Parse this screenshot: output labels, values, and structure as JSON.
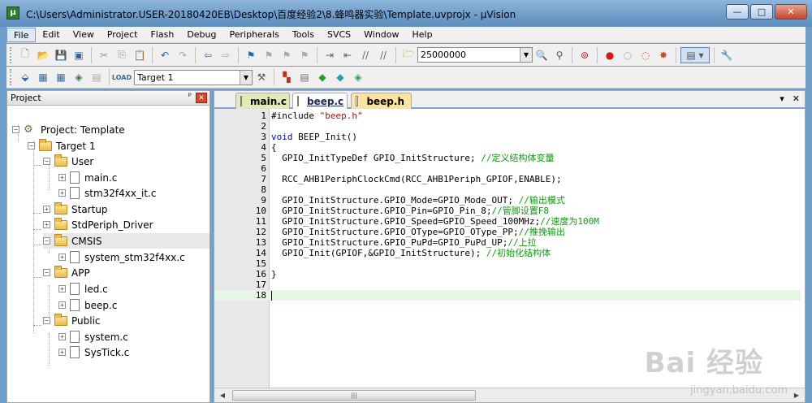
{
  "window": {
    "title": "C:\\Users\\Administrator.USER-20180420EB\\Desktop\\百度经验2\\8.蜂鸣器实验\\Template.uvprojx - µVision",
    "app_icon": "uvision-icon",
    "buttons": {
      "minimize": "—",
      "maximize": "□",
      "close": "✕"
    }
  },
  "menu": [
    "File",
    "Edit",
    "View",
    "Project",
    "Flash",
    "Debug",
    "Peripherals",
    "Tools",
    "SVCS",
    "Window",
    "Help"
  ],
  "toolbar": {
    "find_value": "25000000",
    "target_value": "Target 1"
  },
  "project_panel": {
    "title": "Project",
    "pin": "ᵖ",
    "close": "✕",
    "tree": [
      {
        "label": "Project: Template",
        "type": "project"
      },
      {
        "label": "Target 1",
        "type": "target"
      },
      {
        "label": "User",
        "type": "folder"
      },
      {
        "label": "main.c",
        "type": "file"
      },
      {
        "label": "stm32f4xx_it.c",
        "type": "file"
      },
      {
        "label": "Startup",
        "type": "folder"
      },
      {
        "label": "StdPeriph_Driver",
        "type": "folder"
      },
      {
        "label": "CMSIS",
        "type": "folder"
      },
      {
        "label": "system_stm32f4xx.c",
        "type": "file"
      },
      {
        "label": "APP",
        "type": "folder"
      },
      {
        "label": "led.c",
        "type": "file"
      },
      {
        "label": "beep.c",
        "type": "file"
      },
      {
        "label": "Public",
        "type": "folder"
      },
      {
        "label": "system.c",
        "type": "file"
      },
      {
        "label": "SysTick.c",
        "type": "file"
      }
    ]
  },
  "tabs": [
    {
      "label": "main.c"
    },
    {
      "label": "beep.c",
      "active": true
    },
    {
      "label": "beep.h"
    }
  ],
  "tab_actions": {
    "menu": "▾",
    "close": "✕"
  },
  "code": [
    {
      "n": "1",
      "parts": [
        {
          "t": "#include ",
          "c": ""
        },
        {
          "t": "\"beep.h\"",
          "c": "str"
        }
      ]
    },
    {
      "n": "2",
      "parts": []
    },
    {
      "n": "3",
      "parts": [
        {
          "t": "void",
          "c": "kw"
        },
        {
          "t": " BEEP_Init()",
          "c": ""
        }
      ]
    },
    {
      "n": "4",
      "parts": [
        {
          "t": "{",
          "c": ""
        }
      ]
    },
    {
      "n": "5",
      "parts": [
        {
          "t": "  GPIO_InitTypeDef GPIO_InitStructure; ",
          "c": ""
        },
        {
          "t": "//定义结构体变量",
          "c": "cmt"
        }
      ]
    },
    {
      "n": "6",
      "parts": []
    },
    {
      "n": "7",
      "parts": [
        {
          "t": "  RCC_AHB1PeriphClockCmd(RCC_AHB1Periph_GPIOF,ENABLE);",
          "c": ""
        }
      ]
    },
    {
      "n": "8",
      "parts": []
    },
    {
      "n": "9",
      "parts": [
        {
          "t": "  GPIO_InitStructure.GPIO_Mode=GPIO_Mode_OUT; ",
          "c": ""
        },
        {
          "t": "//输出模式",
          "c": "cmt"
        }
      ]
    },
    {
      "n": "10",
      "parts": [
        {
          "t": "  GPIO_InitStructure.GPIO_Pin=GPIO_Pin_8;",
          "c": ""
        },
        {
          "t": "//管脚设置F8",
          "c": "cmt"
        }
      ]
    },
    {
      "n": "11",
      "parts": [
        {
          "t": "  GPIO_InitStructure.GPIO_Speed=GPIO_Speed_100MHz;",
          "c": ""
        },
        {
          "t": "//速度为100M",
          "c": "cmt"
        }
      ]
    },
    {
      "n": "12",
      "parts": [
        {
          "t": "  GPIO_InitStructure.GPIO_OType=GPIO_OType_PP;",
          "c": ""
        },
        {
          "t": "//推挽输出",
          "c": "cmt"
        }
      ]
    },
    {
      "n": "13",
      "parts": [
        {
          "t": "  GPIO_InitStructure.GPIO_PuPd=GPIO_PuPd_UP;",
          "c": ""
        },
        {
          "t": "//上拉",
          "c": "cmt"
        }
      ]
    },
    {
      "n": "14",
      "parts": [
        {
          "t": "  GPIO_Init(GPIOF,&GPIO_InitStructure); ",
          "c": ""
        },
        {
          "t": "//初始化结构体",
          "c": "cmt"
        }
      ]
    },
    {
      "n": "15",
      "parts": []
    },
    {
      "n": "16",
      "parts": [
        {
          "t": "}",
          "c": ""
        }
      ]
    },
    {
      "n": "17",
      "parts": []
    },
    {
      "n": "18",
      "parts": [],
      "current": true
    }
  ],
  "watermark": {
    "main": "Bai 经验",
    "sub": "jingyan.baidu.com"
  },
  "colors": {
    "comment": "#119911",
    "keyword": "#0000cc",
    "string": "#a31515",
    "current_line": "#e4f7e4"
  }
}
